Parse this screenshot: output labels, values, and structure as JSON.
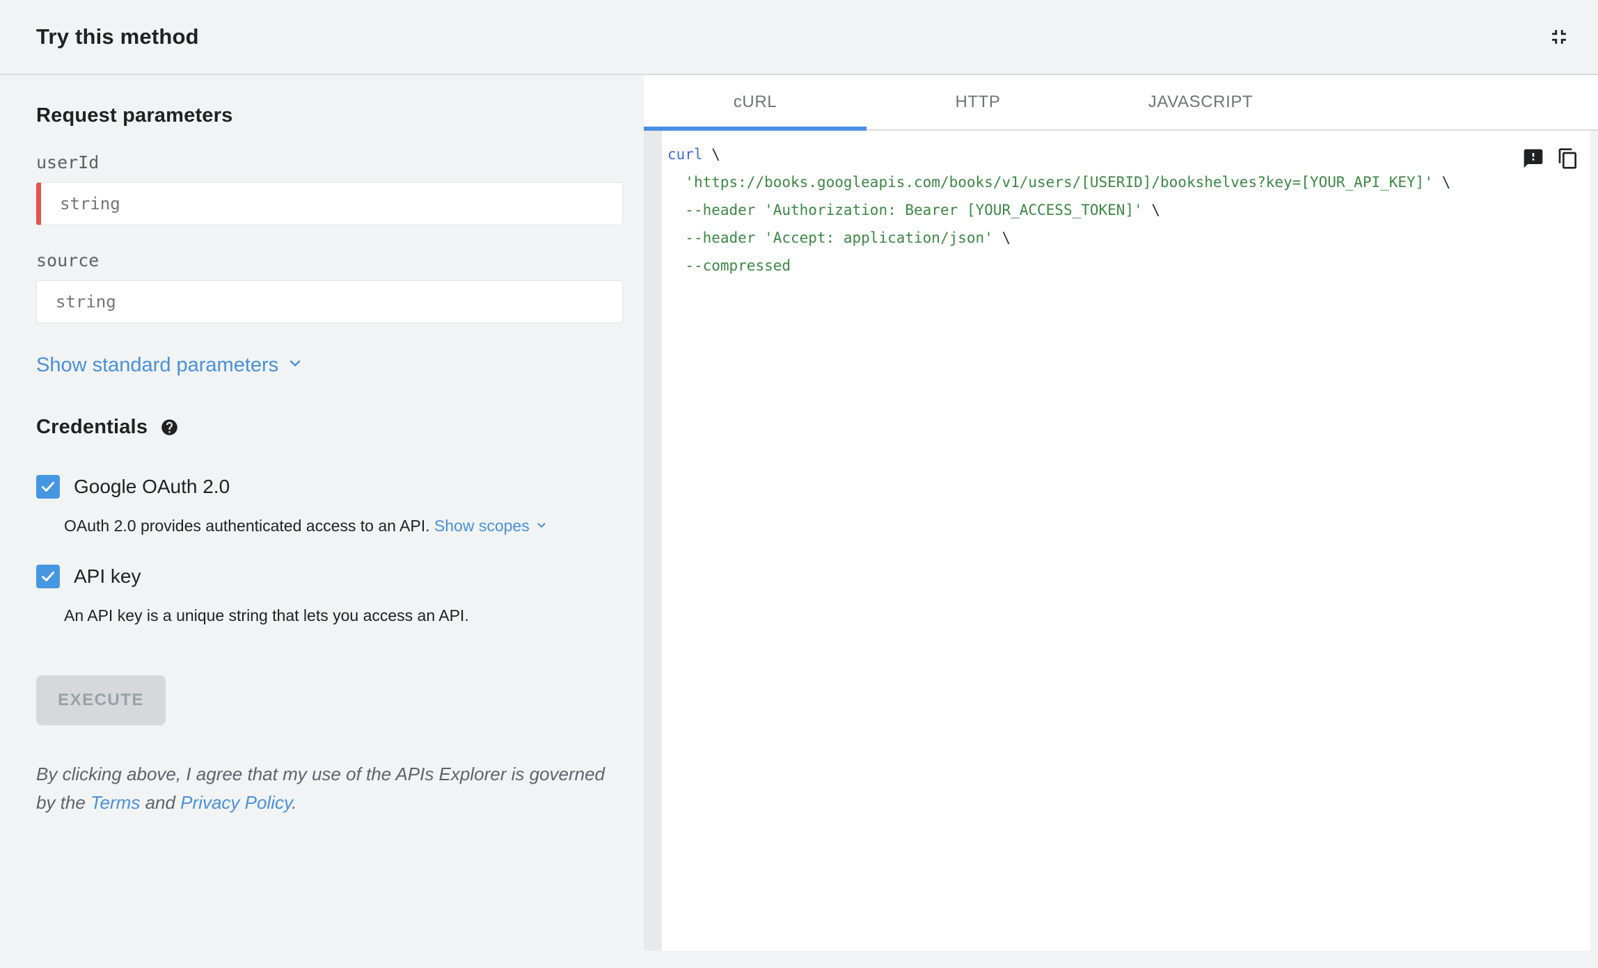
{
  "header": {
    "title": "Try this method"
  },
  "request_parameters": {
    "title": "Request parameters",
    "fields": [
      {
        "label": "userId",
        "placeholder": "string",
        "required": true
      },
      {
        "label": "source",
        "placeholder": "string",
        "required": false
      }
    ],
    "show_standard_parameters_label": "Show standard parameters"
  },
  "credentials": {
    "title": "Credentials",
    "options": [
      {
        "label": "Google OAuth 2.0",
        "checked": true,
        "description": "OAuth 2.0 provides authenticated access to an API. ",
        "link_label": "Show scopes"
      },
      {
        "label": "API key",
        "checked": true,
        "description": "An API key is a unique string that lets you access an API."
      }
    ]
  },
  "execute": {
    "label": "EXECUTE",
    "enabled": false
  },
  "disclaimer": {
    "prefix": "By clicking above, I agree that my use of the APIs Explorer is governed by the ",
    "terms_label": "Terms",
    "middle": " and ",
    "privacy_label": "Privacy Policy",
    "suffix": "."
  },
  "code_panel": {
    "tabs": [
      {
        "label": "cURL",
        "active": true
      },
      {
        "label": "HTTP",
        "active": false
      },
      {
        "label": "JAVASCRIPT",
        "active": false
      }
    ],
    "lines": [
      {
        "tokens": [
          {
            "t": "curl",
            "c": "kw"
          },
          {
            "t": " \\",
            "c": "pl"
          }
        ]
      },
      {
        "tokens": [
          {
            "t": "  ",
            "c": "pl"
          },
          {
            "t": "'https://books.googleapis.com/books/v1/users/[USERID]/bookshelves?key=[YOUR_API_KEY]'",
            "c": "str"
          },
          {
            "t": " \\",
            "c": "pl"
          }
        ]
      },
      {
        "tokens": [
          {
            "t": "  ",
            "c": "pl"
          },
          {
            "t": "--header 'Authorization: Bearer [YOUR_ACCESS_TOKEN]'",
            "c": "str"
          },
          {
            "t": " \\",
            "c": "pl"
          }
        ]
      },
      {
        "tokens": [
          {
            "t": "  ",
            "c": "pl"
          },
          {
            "t": "--header 'Accept: application/json'",
            "c": "str"
          },
          {
            "t": " \\",
            "c": "pl"
          }
        ]
      },
      {
        "tokens": [
          {
            "t": "  ",
            "c": "pl"
          },
          {
            "t": "--compressed",
            "c": "str"
          }
        ]
      }
    ]
  },
  "icons": {
    "header_right": "fullscreen-exit-icon",
    "credentials_help": "help-icon",
    "expander": "chevron-down-icon",
    "code_feedback": "feedback-icon",
    "code_copy": "copy-icon"
  },
  "colors": {
    "page_background": "#f1f3f4",
    "accent_blue": "#4a90d9",
    "checkbox_blue": "#4697e2",
    "tab_underline_blue": "#4a90e2",
    "required_red": "#e05549",
    "code_keyword": "#4069dc",
    "code_string": "#3d8645",
    "code_plain": "#263238",
    "disabled_button_bg": "#d6d8db",
    "disabled_button_text": "#9aa0a6"
  }
}
